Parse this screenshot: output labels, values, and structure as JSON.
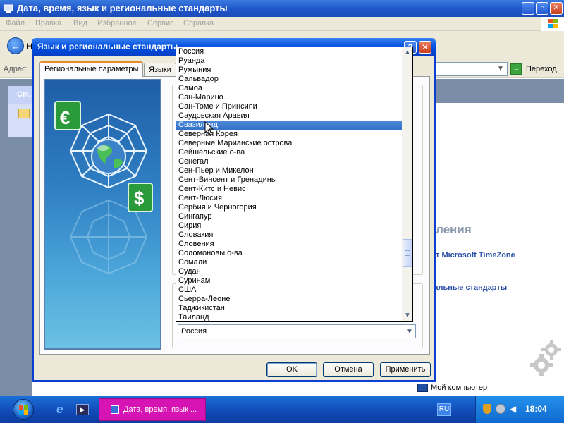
{
  "background_window": {
    "title": "Дата, время, язык и региональные стандарты",
    "menu": [
      "Файл",
      "Правка",
      "Вид",
      "Избранное",
      "Сервис",
      "Справка"
    ],
    "back_label": "Н",
    "address_label": "Адрес:",
    "go_label": "Переход",
    "left_pane_heading": "См.",
    "right_heading": "ления",
    "right_link_1": "т Microsoft TimeZone",
    "right_link_2": "ональные стандарты",
    "desktop_item": "Мой компьютер"
  },
  "dialog": {
    "title": "Язык и региональные стандарты",
    "help_glyph": "?",
    "close_glyph": "✕",
    "tabs": [
      {
        "label": "Региональные параметры",
        "active": true
      },
      {
        "label": "Языки",
        "active": false
      }
    ],
    "country_list": {
      "items": [
        "Россия",
        "Руанда",
        "Румыния",
        "Сальвадор",
        "Самоа",
        "Сан-Марино",
        "Сан-Томе и Принсипи",
        "Саудовская Аравия",
        "Свазиленд",
        "Северная Корея",
        "Северные Марианские острова",
        "Сейшельские о-ва",
        "Сенегал",
        "Сен-Пьер и Микелон",
        "Сент-Винсент и Гренадины",
        "Сент-Китс и Невис",
        "Сент-Люсия",
        "Сербия и Черногория",
        "Сингапур",
        "Сирия",
        "Словакия",
        "Словения",
        "Соломоновы о-ва",
        "Сомали",
        "Судан",
        "Суринам",
        "США",
        "Сьерра-Леоне",
        "Таджикистан",
        "Таиланд"
      ],
      "highlighted": "Свазиленд"
    },
    "location_select_value": "Россия",
    "buttons": {
      "ok": "OK",
      "cancel": "Отмена",
      "apply": "Применить"
    }
  },
  "taskbar": {
    "task_label": "Дата, время, язык ...",
    "language": "RU",
    "clock": "18:04"
  },
  "colors": {
    "titlebar": "#0a56e2",
    "selection": "#3572c8",
    "task_button": "#d614b3",
    "taskbar": "#1048b5"
  }
}
